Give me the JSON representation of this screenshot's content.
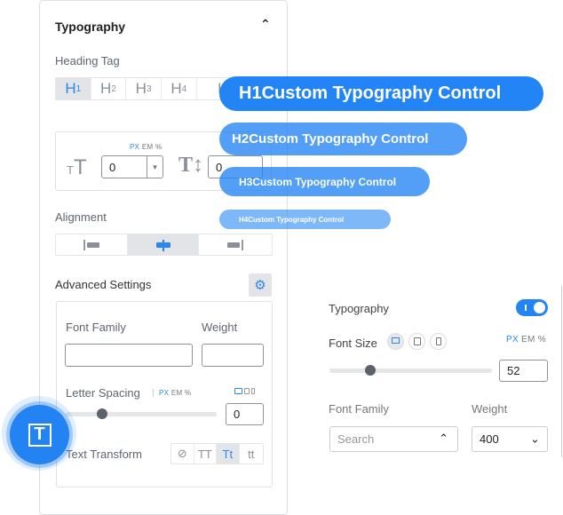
{
  "left_panel": {
    "title": "Typography",
    "heading_tag_label": "Heading Tag",
    "heading_tags": [
      {
        "h": "H",
        "n": "1"
      },
      {
        "h": "H",
        "n": "2"
      },
      {
        "h": "H",
        "n": "3"
      },
      {
        "h": "H",
        "n": "4"
      },
      {
        "h": "H",
        "n": ""
      }
    ],
    "units": {
      "px": "PX",
      "em": "EM",
      "pct": "%"
    },
    "font_size_value": "0",
    "line_height_value": "0",
    "alignment_label": "Alignment",
    "advanced_label": "Advanced Settings",
    "font_family_label": "Font Family",
    "weight_label": "Weight",
    "letter_spacing_label": "Letter Spacing",
    "letter_spacing_value": "0",
    "letter_spacing_slider": 0.24,
    "text_transform_label": "Text Transform",
    "transforms": [
      "TT",
      "Tt",
      "tt"
    ]
  },
  "pills": [
    {
      "tag": "H1",
      "text": "Custom Typography Control"
    },
    {
      "tag": "H2",
      "text": "Custom Typography Control"
    },
    {
      "tag": "H3",
      "text": "Custom Typography Control"
    },
    {
      "tag": "H4",
      "text": "Custom Typography Control"
    }
  ],
  "right_panel": {
    "title": "Typography",
    "toggle_on": true,
    "font_size_label": "Font Size",
    "units": {
      "px": "PX",
      "em": "EM",
      "pct": "%"
    },
    "font_size_value": "52",
    "font_size_slider": 0.25,
    "font_family_label": "Font Family",
    "font_family_placeholder": "Search",
    "weight_label": "Weight",
    "weight_value": "400"
  },
  "colors": {
    "accent": "#2b87f0"
  }
}
